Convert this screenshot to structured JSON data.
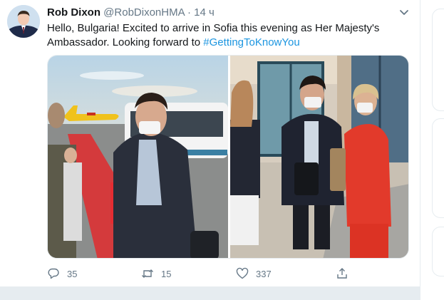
{
  "tweet": {
    "author_name": "Rob Dixon",
    "author_handle": "@RobDixonHMA",
    "separator": "·",
    "timestamp": "14 ч",
    "text_line1": "Hello, Bulgaria! Excited to arrive in Sofia this evening as Her Majesty's",
    "text_line2_prefix": "Ambassador. Looking forward to",
    "hashtag": "#GettingToKnowYou",
    "media": [
      {
        "description_icon": "photo"
      },
      {
        "description_icon": "photo"
      }
    ],
    "actions": {
      "reply_count": "35",
      "retweet_count": "15",
      "like_count": "337"
    }
  },
  "colors": {
    "accent": "#1b95e0",
    "muted": "#657786",
    "border": "#e6ecf0"
  },
  "icons": {
    "caret": "chevron-down-icon",
    "reply": "reply-icon",
    "retweet": "retweet-icon",
    "like": "heart-icon",
    "share": "share-icon"
  }
}
